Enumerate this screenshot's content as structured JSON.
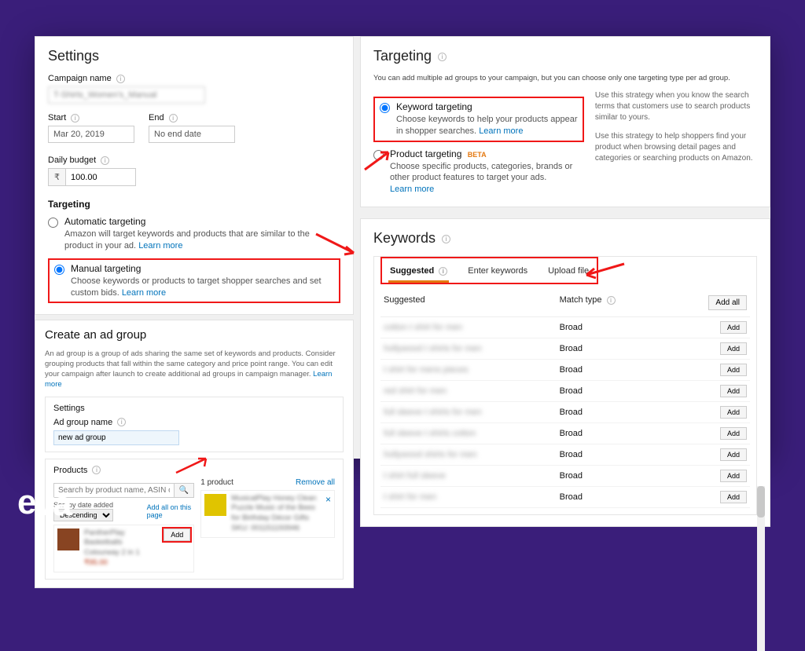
{
  "settings": {
    "heading": "Settings",
    "campaign_name_label": "Campaign name",
    "campaign_name_value": "T-Shirts_Women's_Manual",
    "start_label": "Start",
    "start_value": "Mar 20, 2019",
    "end_label": "End",
    "end_value": "No end date",
    "budget_label": "Daily budget",
    "budget_currency": "₹",
    "budget_value": "100.00",
    "targeting_label": "Targeting",
    "auto_title": "Automatic targeting",
    "auto_desc": "Amazon will target keywords and products that are similar to the product in your ad.",
    "manual_title": "Manual targeting",
    "manual_desc": "Choose keywords or products to target shopper searches and set custom bids.",
    "learn_more": "Learn more"
  },
  "adgroup": {
    "heading": "Create an ad group",
    "desc": "An ad group is a group of ads sharing the same set of keywords and products. Consider grouping products that fall within the same category and price point range. You can edit your campaign after launch to create additional ad groups in campaign manager.",
    "learn_more": "Learn more",
    "settings_heading": "Settings",
    "adgroup_name_label": "Ad group name",
    "adgroup_name_value": "new ad group",
    "products_heading": "Products",
    "search_placeholder": "Search by product name, ASIN or SKU",
    "sort_label": "Sort by date added",
    "sort_value": "Descending",
    "add_all_link": "Add all on this page",
    "selected_count": "1 product",
    "remove_all": "Remove all",
    "add_label": "Add"
  },
  "targeting": {
    "heading": "Targeting",
    "intro": "You can add multiple ad groups to your campaign, but you can choose only one targeting type per ad group.",
    "kw_title": "Keyword targeting",
    "kw_desc": "Choose keywords to help your products appear in shopper searches.",
    "prod_title": "Product targeting",
    "prod_desc": "Choose specific products, categories, brands or other product features to target your ads.",
    "learn_more": "Learn more",
    "beta_tag": "BETA",
    "aside_kw": "Use this strategy when you know the search terms that customers use to search products similar to yours.",
    "aside_prod": "Use this strategy to help shoppers find your product when browsing detail pages and categories or searching products on Amazon."
  },
  "keywords": {
    "heading": "Keywords",
    "tab_suggested": "Suggested",
    "tab_enter": "Enter keywords",
    "tab_upload": "Upload file",
    "col_suggested": "Suggested",
    "col_match": "Match type",
    "add_all": "Add all",
    "add": "Add",
    "rows": [
      {
        "kw": "cotton t shirt for men",
        "match": "Broad"
      },
      {
        "kw": "hollywood t shirts for men",
        "match": "Broad"
      },
      {
        "kw": "t shirt for mens pieces",
        "match": "Broad"
      },
      {
        "kw": "red shirt for men",
        "match": "Broad"
      },
      {
        "kw": "full sleeve t shirts for men",
        "match": "Broad"
      },
      {
        "kw": "full sleeve t shirts cotton",
        "match": "Broad"
      },
      {
        "kw": "hollywood shirts for men",
        "match": "Broad"
      },
      {
        "kw": "t shirt full sleeve",
        "match": "Broad"
      },
      {
        "kw": "t shirt for men",
        "match": "Broad"
      }
    ]
  },
  "logo_text": "eva"
}
